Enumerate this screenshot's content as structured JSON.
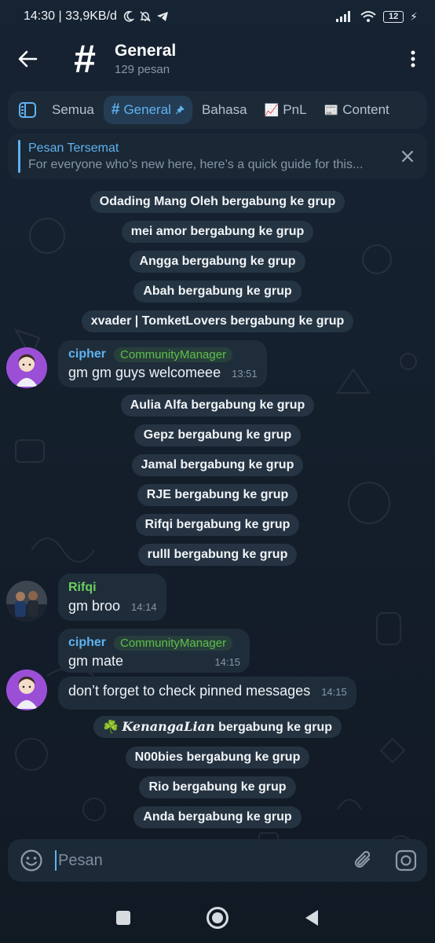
{
  "status_bar": {
    "time_speed": "14:30 | 33,9KB/d",
    "battery": "12"
  },
  "header": {
    "title": "General",
    "subtitle": "129 pesan",
    "topic_symbol": "#"
  },
  "tabs": [
    {
      "label": "Semua"
    },
    {
      "label": "General",
      "icon": "#"
    },
    {
      "label": "Bahasa"
    },
    {
      "label": "PnL",
      "icon": "📈"
    },
    {
      "label": "Content",
      "icon": "📰"
    }
  ],
  "pinned": {
    "title": "Pesan Tersemat",
    "text": "For everyone who’s new here, here’s a quick guide for this..."
  },
  "service_messages": [
    "Odading Mang Oleh bergabung ke grup",
    "mei amor bergabung ke grup",
    "Angga bergabung ke grup",
    "Abah bergabung ke grup",
    "xvader | TomketLovers bergabung ke grup",
    "Aulia Alfa bergabung ke grup",
    "Gepz bergabung ke grup",
    "Jamal bergabung ke grup",
    "RJE bergabung ke grup",
    "Rifqi bergabung ke grup",
    "rulll bergabung ke grup",
    "N00bies bergabung ke grup",
    "Rio bergabung ke grup",
    "Anda bergabung ke grup"
  ],
  "kenanga_join": {
    "prefix": "☘️",
    "name": "KenangaLian",
    "suffix": "bergabung ke grup"
  },
  "messages": [
    {
      "sender": "cipher",
      "role": "CommunityManager",
      "text": "gm gm guys welcomeee",
      "time": "13:51"
    },
    {
      "sender": "Rifqi",
      "text": "gm broo",
      "time": "14:14"
    },
    {
      "sender": "cipher",
      "role": "CommunityManager",
      "text": "gm mate",
      "time": "14:15"
    },
    {
      "text": "don’t forget to check pinned messages",
      "time": "14:15"
    }
  ],
  "composer": {
    "placeholder": "Pesan"
  },
  "colors": {
    "accent": "#5fb3f0",
    "role_green": "#5fbf4b",
    "bubble": "#1f2d3b",
    "background": "#0f1823"
  }
}
